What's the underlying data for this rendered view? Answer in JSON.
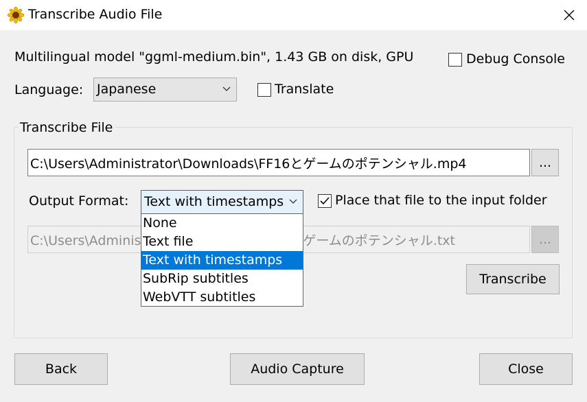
{
  "window": {
    "title": "Transcribe Audio File",
    "app_icon": "sunflower-icon",
    "close_icon": "close-icon"
  },
  "model_info": "Multilingual model \"ggml-medium.bin\", 1.43 GB on disk, GPU",
  "debug_console": {
    "label": "Debug Console",
    "checked": false
  },
  "language": {
    "label": "Language:",
    "value": "Japanese"
  },
  "translate": {
    "label": "Translate",
    "checked": false
  },
  "transcribe_file": {
    "group_title": "Transcribe File",
    "input_path": "C:\\Users\\Administrator\\Downloads\\FF16とゲームのポテンシャル.mp4",
    "browse_label": "...",
    "output_format_label": "Output Format:",
    "output_format_value": "Text with timestamps",
    "output_format_options": [
      "None",
      "Text file",
      "Text with timestamps",
      "SubRip subtitles",
      "WebVTT subtitles"
    ],
    "selected_option": "Text with timestamps",
    "place_in_input_folder": {
      "label": "Place that file to the input folder",
      "checked": true
    },
    "output_path": "C:\\Users\\Administrator\\Downloads\\FF16とゲームのポテンシャル.txt",
    "output_browse_label": "...",
    "transcribe_button": "Transcribe"
  },
  "footer": {
    "back_button": "Back",
    "audio_capture_button": "Audio Capture",
    "close_button": "Close"
  },
  "colors": {
    "selection": "#0078d7",
    "dialog_bg": "#f0f0f0",
    "button_bg": "#e1e1e1"
  }
}
